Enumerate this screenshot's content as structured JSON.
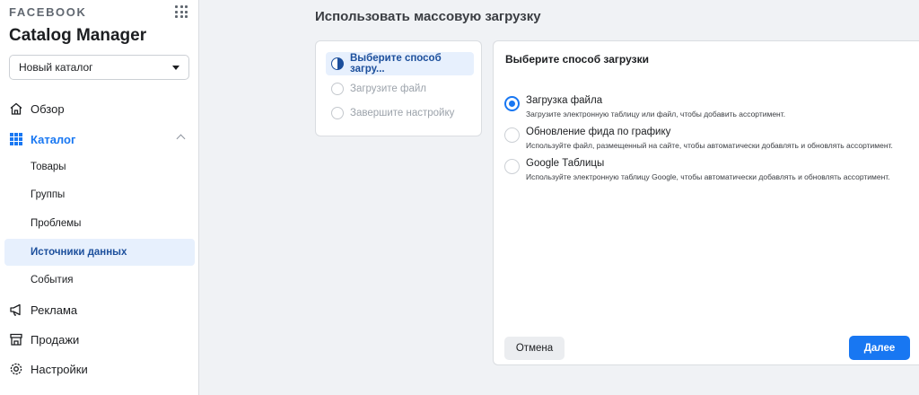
{
  "sidebar": {
    "brand": "FACEBOOK",
    "app_title": "Catalog Manager",
    "catalog_select": {
      "value": "Новый каталог"
    },
    "nav": {
      "overview": "Обзор",
      "catalog": "Каталог",
      "ads": "Реклама",
      "sales": "Продажи",
      "settings": "Настройки"
    },
    "catalog_sub": [
      "Товары",
      "Группы",
      "Проблемы",
      "Источники данных",
      "События"
    ],
    "accent_color": "#1877f2"
  },
  "main": {
    "title": "Использовать массовую загрузку",
    "steps": [
      "Выберите способ загру...",
      "Загрузите файл",
      "Завершите настройку"
    ],
    "card_title": "Выберите способ загрузки",
    "options": [
      {
        "label": "Загрузка файла",
        "desc": "Загрузите электронную таблицу или файл, чтобы добавить ассортимент.",
        "selected": true
      },
      {
        "label": "Обновление фида по графику",
        "desc": "Используйте файл, размещенный на сайте, чтобы автоматически добавлять и обновлять ассортимент.",
        "selected": false
      },
      {
        "label": "Google Таблицы",
        "desc": "Используйте электронную таблицу Google, чтобы автоматически добавлять и обновлять ассортимент.",
        "selected": false
      }
    ],
    "buttons": {
      "cancel": "Отмена",
      "next": "Далее"
    }
  }
}
